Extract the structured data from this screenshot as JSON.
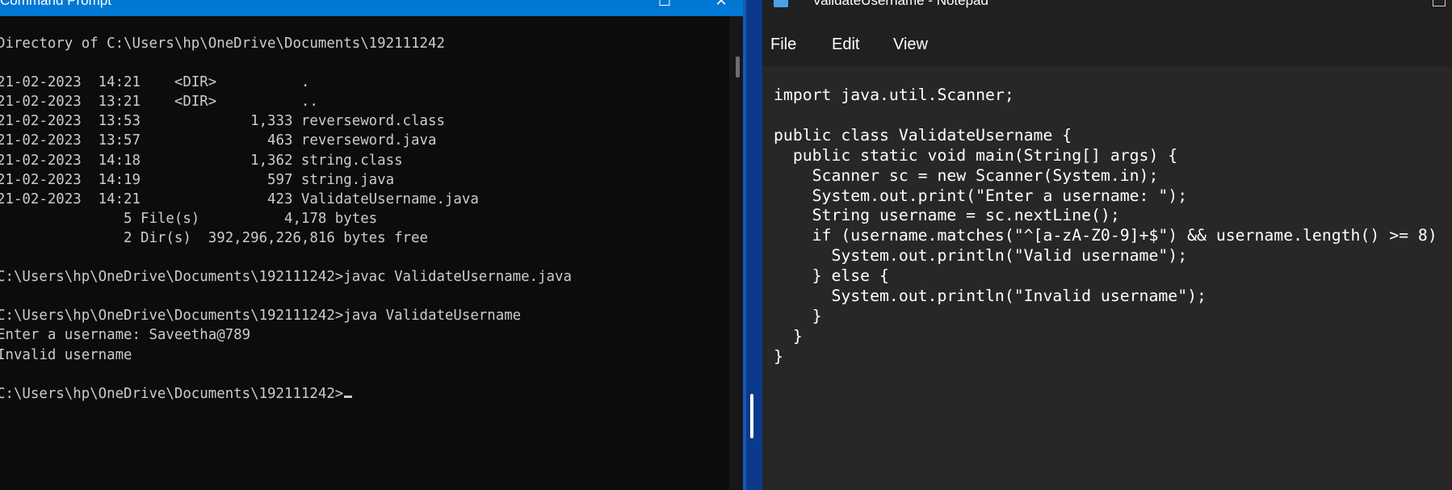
{
  "cmd": {
    "title": "Command Prompt",
    "buttons": {
      "maximize": "☐",
      "close": "✕"
    },
    "lines": [
      "Directory of C:\\Users\\hp\\OneDrive\\Documents\\192111242",
      "",
      "21-02-2023  14:21    <DIR>          .",
      "21-02-2023  13:21    <DIR>          ..",
      "21-02-2023  13:53             1,333 reverseword.class",
      "21-02-2023  13:57               463 reverseword.java",
      "21-02-2023  14:18             1,362 string.class",
      "21-02-2023  14:19               597 string.java",
      "21-02-2023  14:21               423 ValidateUsername.java",
      "               5 File(s)          4,178 bytes",
      "               2 Dir(s)  392,296,226,816 bytes free",
      "",
      "C:\\Users\\hp\\OneDrive\\Documents\\192111242>javac ValidateUsername.java",
      "",
      "C:\\Users\\hp\\OneDrive\\Documents\\192111242>java ValidateUsername",
      "Enter a username: Saveetha@789",
      "Invalid username",
      ""
    ],
    "prompt": "C:\\Users\\hp\\OneDrive\\Documents\\192111242>"
  },
  "notepad": {
    "title": "ValidateUsername - Notepad",
    "menu": {
      "file": "File",
      "edit": "Edit",
      "view": "View"
    },
    "code_lines": [
      "import java.util.Scanner;",
      "",
      "public class ValidateUsername {",
      "  public static void main(String[] args) {",
      "    Scanner sc = new Scanner(System.in);",
      "    System.out.print(\"Enter a username: \");",
      "    String username = sc.nextLine();",
      "    if (username.matches(\"^[a-zA-Z0-9]+$\") && username.length() >= 8)",
      "      System.out.println(\"Valid username\");",
      "    } else {",
      "      System.out.println(\"Invalid username\");",
      "    }",
      "  }",
      "}"
    ]
  }
}
